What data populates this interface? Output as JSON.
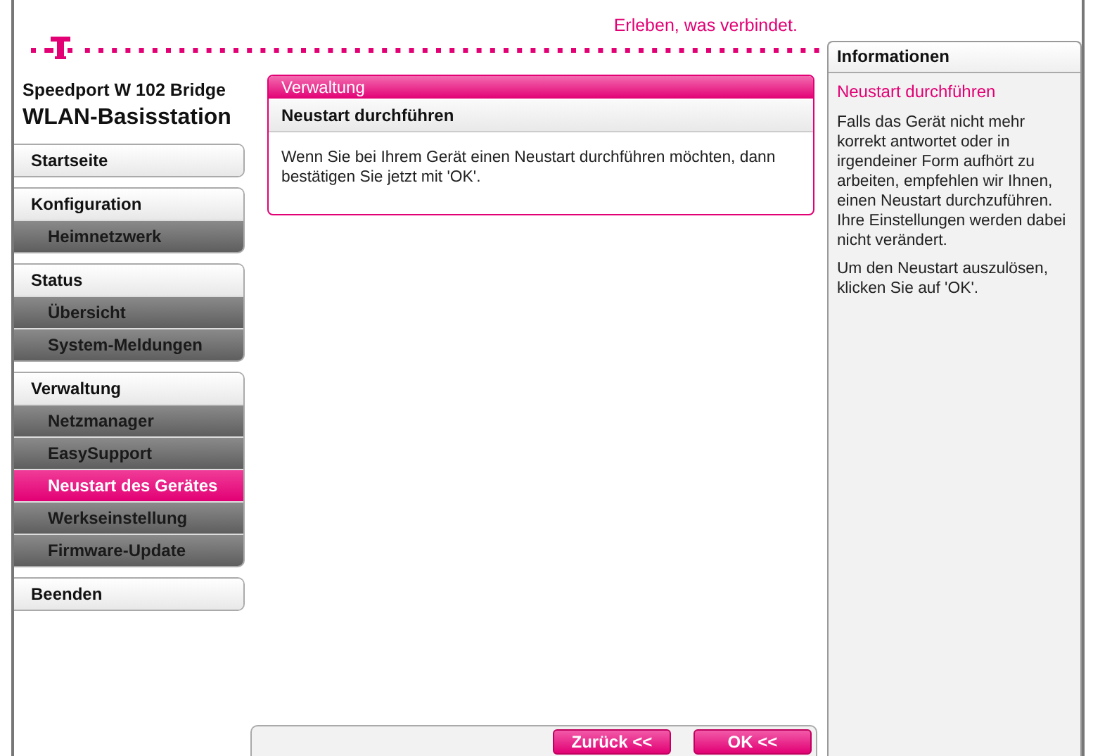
{
  "header": {
    "tagline": "Erleben, was verbindet."
  },
  "device": {
    "model": "Speedport W 102 Bridge",
    "name": "WLAN-Basisstation"
  },
  "sidebar": {
    "groups": [
      {
        "label": "Startseite"
      },
      {
        "label": "Konfiguration",
        "items": [
          {
            "label": "Heimnetzwerk",
            "selected": false
          }
        ]
      },
      {
        "label": "Status",
        "items": [
          {
            "label": "Übersicht",
            "selected": false
          },
          {
            "label": "System-Meldungen",
            "selected": false
          }
        ]
      },
      {
        "label": "Verwaltung",
        "items": [
          {
            "label": "Netzmanager",
            "selected": false
          },
          {
            "label": "EasySupport",
            "selected": false
          },
          {
            "label": "Neustart des Gerätes",
            "selected": true
          },
          {
            "label": "Werkseinstellung",
            "selected": false
          },
          {
            "label": "Firmware-Update",
            "selected": false
          }
        ]
      },
      {
        "label": "Beenden"
      }
    ]
  },
  "panel": {
    "section": "Verwaltung",
    "title": "Neustart durchführen",
    "text": "Wenn Sie bei Ihrem Gerät einen Neustart durchführen möchten, dann bestätigen Sie jetzt mit 'OK'."
  },
  "buttons": [
    "Zurück <<",
    "OK <<"
  ],
  "info": {
    "title": "Informationen",
    "heading": "Neustart durchführen",
    "paragraphs": [
      "Falls das Gerät nicht mehr korrekt antwortet oder in irgendeiner Form aufhört zu arbeiten, empfehlen wir Ihnen, einen Neustart durchzuführen. Ihre Einstellungen werden dabei nicht verändert.",
      "Um den Neustart auszulösen, klicken Sie auf 'OK'."
    ]
  }
}
